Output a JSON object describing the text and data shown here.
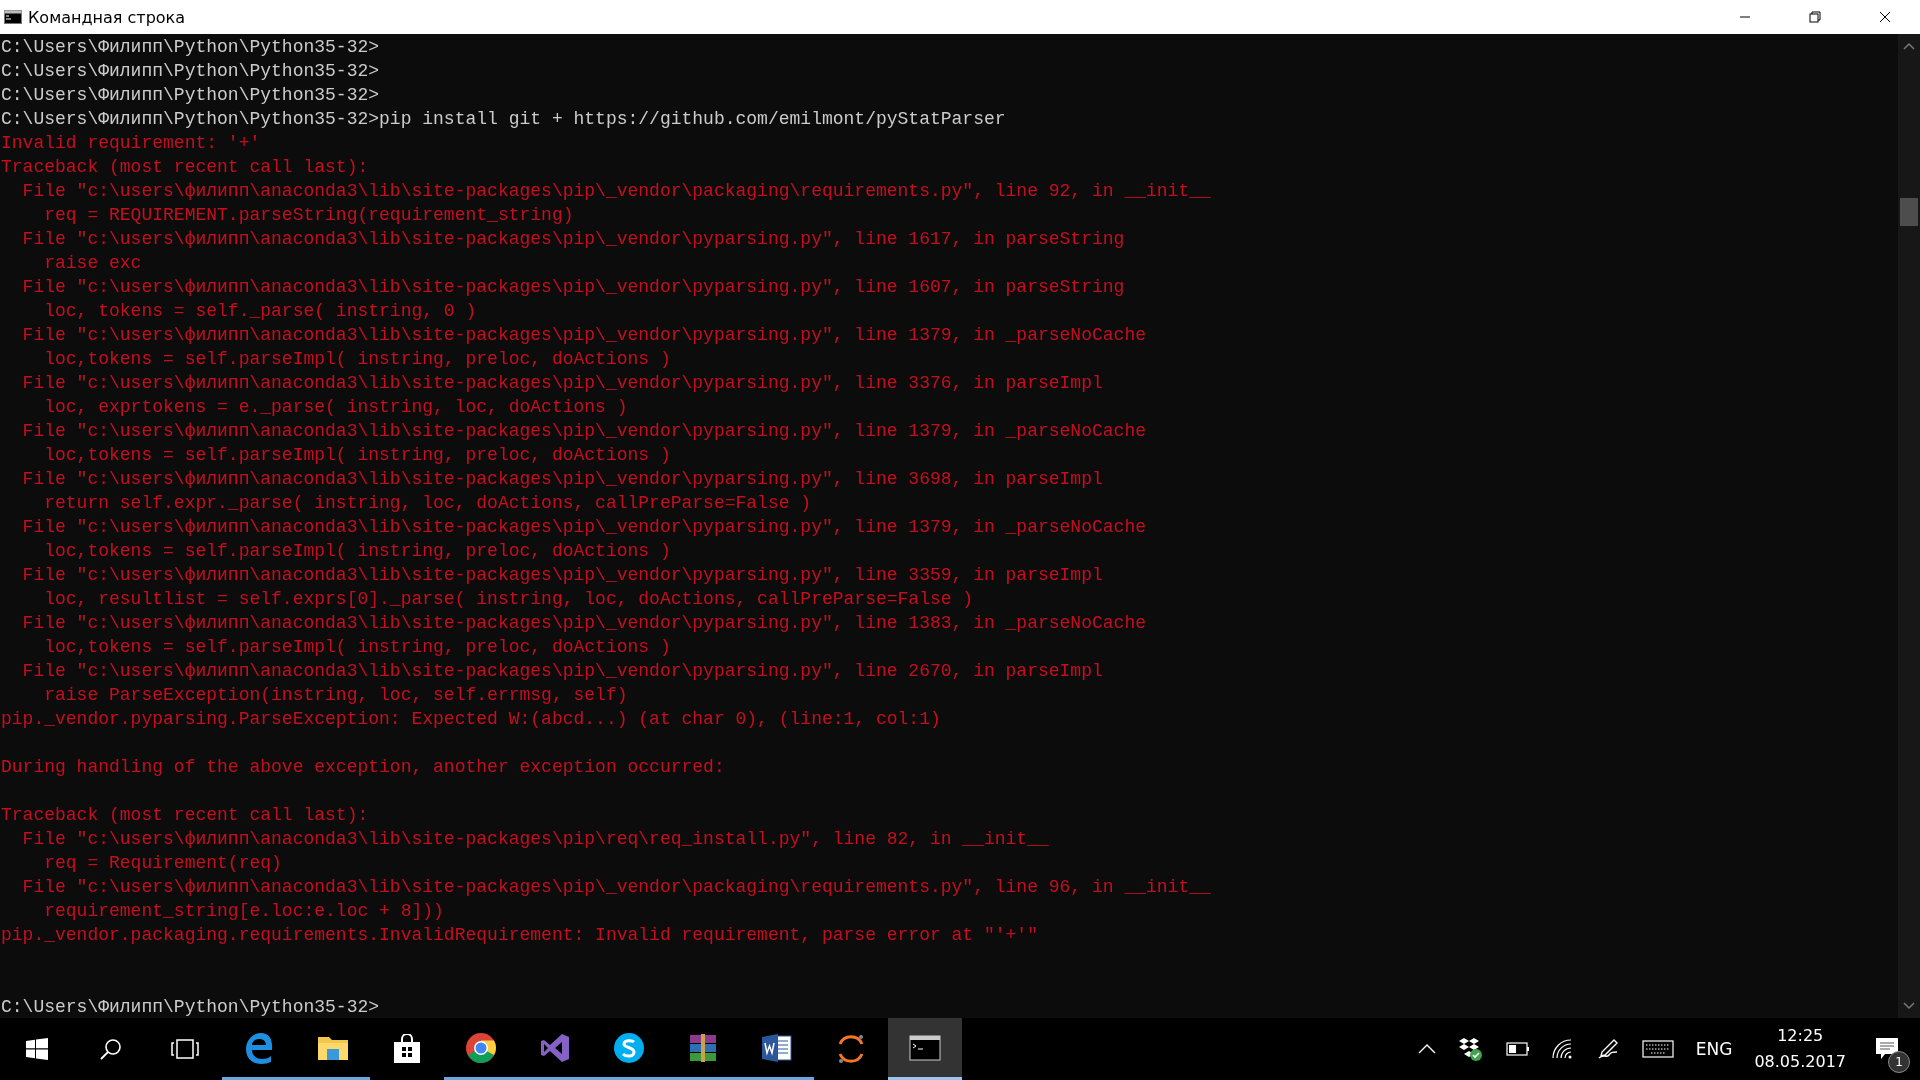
{
  "window": {
    "title": "Командная строка"
  },
  "console": {
    "lines": [
      {
        "kind": "normal",
        "text": "C:\\Users\\Филипп\\Python\\Python35-32>"
      },
      {
        "kind": "normal",
        "text": "C:\\Users\\Филипп\\Python\\Python35-32>"
      },
      {
        "kind": "normal",
        "text": "C:\\Users\\Филипп\\Python\\Python35-32>"
      },
      {
        "kind": "normal",
        "text": "C:\\Users\\Филипп\\Python\\Python35-32>pip install git + https://github.com/emilmont/pyStatParser"
      },
      {
        "kind": "error",
        "text": "Invalid requirement: '+'"
      },
      {
        "kind": "error",
        "text": "Traceback (most recent call last):"
      },
      {
        "kind": "error",
        "text": "  File \"c:\\users\\филипп\\anaconda3\\lib\\site-packages\\pip\\_vendor\\packaging\\requirements.py\", line 92, in __init__"
      },
      {
        "kind": "error",
        "text": "    req = REQUIREMENT.parseString(requirement_string)"
      },
      {
        "kind": "error",
        "text": "  File \"c:\\users\\филипп\\anaconda3\\lib\\site-packages\\pip\\_vendor\\pyparsing.py\", line 1617, in parseString"
      },
      {
        "kind": "error",
        "text": "    raise exc"
      },
      {
        "kind": "error",
        "text": "  File \"c:\\users\\филипп\\anaconda3\\lib\\site-packages\\pip\\_vendor\\pyparsing.py\", line 1607, in parseString"
      },
      {
        "kind": "error",
        "text": "    loc, tokens = self._parse( instring, 0 )"
      },
      {
        "kind": "error",
        "text": "  File \"c:\\users\\филипп\\anaconda3\\lib\\site-packages\\pip\\_vendor\\pyparsing.py\", line 1379, in _parseNoCache"
      },
      {
        "kind": "error",
        "text": "    loc,tokens = self.parseImpl( instring, preloc, doActions )"
      },
      {
        "kind": "error",
        "text": "  File \"c:\\users\\филипп\\anaconda3\\lib\\site-packages\\pip\\_vendor\\pyparsing.py\", line 3376, in parseImpl"
      },
      {
        "kind": "error",
        "text": "    loc, exprtokens = e._parse( instring, loc, doActions )"
      },
      {
        "kind": "error",
        "text": "  File \"c:\\users\\филипп\\anaconda3\\lib\\site-packages\\pip\\_vendor\\pyparsing.py\", line 1379, in _parseNoCache"
      },
      {
        "kind": "error",
        "text": "    loc,tokens = self.parseImpl( instring, preloc, doActions )"
      },
      {
        "kind": "error",
        "text": "  File \"c:\\users\\филипп\\anaconda3\\lib\\site-packages\\pip\\_vendor\\pyparsing.py\", line 3698, in parseImpl"
      },
      {
        "kind": "error",
        "text": "    return self.expr._parse( instring, loc, doActions, callPreParse=False )"
      },
      {
        "kind": "error",
        "text": "  File \"c:\\users\\филипп\\anaconda3\\lib\\site-packages\\pip\\_vendor\\pyparsing.py\", line 1379, in _parseNoCache"
      },
      {
        "kind": "error",
        "text": "    loc,tokens = self.parseImpl( instring, preloc, doActions )"
      },
      {
        "kind": "error",
        "text": "  File \"c:\\users\\филипп\\anaconda3\\lib\\site-packages\\pip\\_vendor\\pyparsing.py\", line 3359, in parseImpl"
      },
      {
        "kind": "error",
        "text": "    loc, resultlist = self.exprs[0]._parse( instring, loc, doActions, callPreParse=False )"
      },
      {
        "kind": "error",
        "text": "  File \"c:\\users\\филипп\\anaconda3\\lib\\site-packages\\pip\\_vendor\\pyparsing.py\", line 1383, in _parseNoCache"
      },
      {
        "kind": "error",
        "text": "    loc,tokens = self.parseImpl( instring, preloc, doActions )"
      },
      {
        "kind": "error",
        "text": "  File \"c:\\users\\филипп\\anaconda3\\lib\\site-packages\\pip\\_vendor\\pyparsing.py\", line 2670, in parseImpl"
      },
      {
        "kind": "error",
        "text": "    raise ParseException(instring, loc, self.errmsg, self)"
      },
      {
        "kind": "error",
        "text": "pip._vendor.pyparsing.ParseException: Expected W:(abcd...) (at char 0), (line:1, col:1)"
      },
      {
        "kind": "blank"
      },
      {
        "kind": "error",
        "text": "During handling of the above exception, another exception occurred:"
      },
      {
        "kind": "blank"
      },
      {
        "kind": "error",
        "text": "Traceback (most recent call last):"
      },
      {
        "kind": "error",
        "text": "  File \"c:\\users\\филипп\\anaconda3\\lib\\site-packages\\pip\\req\\req_install.py\", line 82, in __init__"
      },
      {
        "kind": "error",
        "text": "    req = Requirement(req)"
      },
      {
        "kind": "error",
        "text": "  File \"c:\\users\\филипп\\anaconda3\\lib\\site-packages\\pip\\_vendor\\packaging\\requirements.py\", line 96, in __init__"
      },
      {
        "kind": "error",
        "text": "    requirement_string[e.loc:e.loc + 8]))"
      },
      {
        "kind": "error",
        "text": "pip._vendor.packaging.requirements.InvalidRequirement: Invalid requirement, parse error at \"'+'\""
      },
      {
        "kind": "blank"
      },
      {
        "kind": "blank"
      },
      {
        "kind": "normal",
        "text": "C:\\Users\\Филипп\\Python\\Python35-32>"
      }
    ]
  },
  "taskbar": {
    "apps": [
      {
        "running": true,
        "selected": false
      },
      {
        "running": true,
        "selected": false
      },
      {
        "running": false,
        "selected": false
      },
      {
        "running": true,
        "selected": false
      },
      {
        "running": true,
        "selected": false
      },
      {
        "running": true,
        "selected": false
      },
      {
        "running": true,
        "selected": false
      },
      {
        "running": true,
        "selected": false
      },
      {
        "running": false,
        "selected": false
      },
      {
        "running": true,
        "selected": true
      }
    ],
    "language": "ENG",
    "time": "12:25",
    "date": "08.05.2017",
    "notification_count": "1"
  }
}
